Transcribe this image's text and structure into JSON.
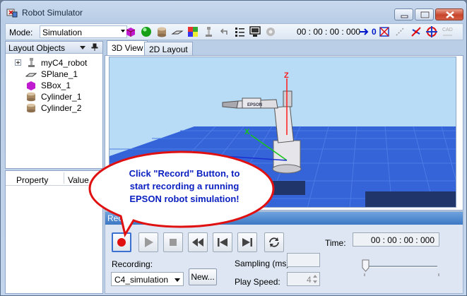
{
  "window": {
    "title": "Robot Simulator"
  },
  "toolbar": {
    "mode_label": "Mode:",
    "mode_value": "Simulation",
    "time": "00 : 00 : 00 : 000",
    "zero_label": "0",
    "icons": [
      "add-box-icon",
      "add-sphere-icon",
      "add-cylinder-icon",
      "add-plane-icon",
      "palette-icon",
      "robot-arm-icon",
      "undo-icon",
      "object-list-icon",
      "monitor-icon",
      "settings-icon",
      "move-to-zero-icon",
      "collision-icon",
      "path-icon",
      "coordinate-icon",
      "target-icon",
      "cad-icon"
    ]
  },
  "layout_panel": {
    "title": "Layout Objects",
    "items": [
      {
        "label": "myC4_robot",
        "icon": "robot-icon",
        "expandable": true
      },
      {
        "label": "SPlane_1",
        "icon": "plane-icon"
      },
      {
        "label": "SBox_1",
        "icon": "box-icon"
      },
      {
        "label": "Cylinder_1",
        "icon": "cylinder-icon"
      },
      {
        "label": "Cylinder_2",
        "icon": "cylinder-icon"
      }
    ]
  },
  "property_panel": {
    "col_property": "Property",
    "col_value": "Value"
  },
  "tabs": [
    {
      "label": "3D View",
      "active": true
    },
    {
      "label": "2D Layout",
      "active": false
    }
  ],
  "viewport": {
    "axis_z": "Z",
    "axis_x": "X",
    "colors": {
      "sky": "#b8dcf6",
      "floor": "#3563d8",
      "z_axis": "#ff1a1a",
      "x_axis": "#17c417"
    }
  },
  "recorder": {
    "title": "Reco",
    "recording_label": "Recording:",
    "recording_value": "C4_simulation",
    "new_button": "New...",
    "sampling_label": "Sampling (ms):",
    "play_speed_label": "Play Speed:",
    "play_speed_value": "4",
    "time_label": "Time:",
    "time_value": "00 : 00 : 00 : 000",
    "slider_position": 0
  },
  "callout": {
    "lines": [
      "Click \"Record\" Button, to",
      "start recording a running",
      "EPSON robot simulation!"
    ]
  }
}
